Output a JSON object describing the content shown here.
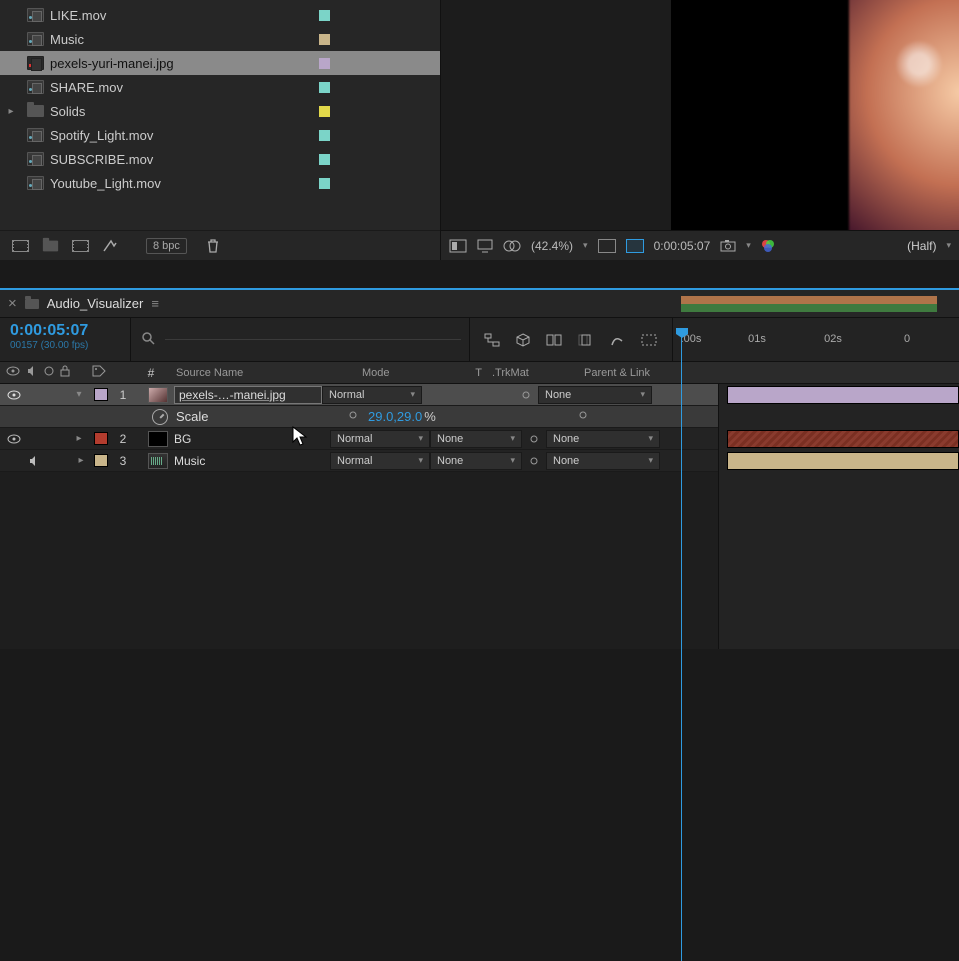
{
  "project": {
    "items": [
      {
        "name": "LIKE.mov",
        "kind": "mov",
        "label": "teal",
        "selected": false
      },
      {
        "name": "Music",
        "kind": "audio",
        "label": "sand",
        "selected": false
      },
      {
        "name": "pexels-yuri-manei.jpg",
        "kind": "image",
        "label": "lav",
        "selected": true
      },
      {
        "name": "SHARE.mov",
        "kind": "mov",
        "label": "teal",
        "selected": false
      },
      {
        "name": "Solids",
        "kind": "folder",
        "label": "yel",
        "selected": false
      },
      {
        "name": "Spotify_Light.mov",
        "kind": "mov",
        "label": "teal",
        "selected": false
      },
      {
        "name": "SUBSCRIBE.mov",
        "kind": "mov",
        "label": "teal",
        "selected": false
      },
      {
        "name": "Youtube_Light.mov",
        "kind": "mov",
        "label": "teal",
        "selected": false
      }
    ],
    "bpc": "8 bpc"
  },
  "viewer": {
    "zoom": "(42.4%)",
    "timecode": "0:00:05:07",
    "resolution": "(Half)"
  },
  "timeline": {
    "comp_name": "Audio_Visualizer",
    "current_time": "0:00:05:07",
    "frame_info": "00157 (30.00 fps)",
    "ruler": [
      ":00s",
      "01s",
      "02s",
      "0"
    ],
    "columns": {
      "hash": "#",
      "source": "Source Name",
      "mode": "Mode",
      "t": "T",
      "trkmat": ".TrkMat",
      "parent": "Parent & Link"
    },
    "layers": [
      {
        "num": "1",
        "name": "pexels-…-manei.jpg",
        "mode": "Normal",
        "trk": "",
        "parent": "None",
        "swatch": "lav",
        "thumb": "img",
        "eye": true,
        "audio": false,
        "open": true,
        "selected": true
      },
      {
        "num": "2",
        "name": "BG",
        "mode": "Normal",
        "trk": "None",
        "parent": "None",
        "swatch": "red",
        "thumb": "solid",
        "eye": true,
        "audio": false,
        "open": false,
        "selected": false
      },
      {
        "num": "3",
        "name": "Music",
        "mode": "Normal",
        "trk": "None",
        "parent": "None",
        "swatch": "sand",
        "thumb": "audio",
        "eye": false,
        "audio": true,
        "open": false,
        "selected": false
      }
    ],
    "prop": {
      "name": "Scale",
      "value": "29.0,29.0",
      "unit": "%"
    }
  }
}
